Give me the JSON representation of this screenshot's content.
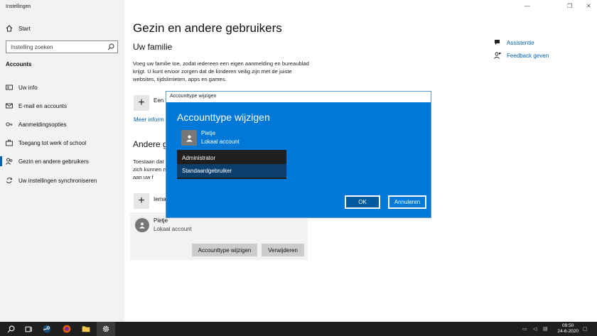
{
  "window": {
    "title": "Instellingen",
    "minimize": "—",
    "maximize": "❐",
    "close": "✕"
  },
  "sidebar": {
    "home_label": "Start",
    "search_placeholder": "Instelling zoeken",
    "section_title": "Accounts",
    "items": [
      {
        "label": "Uw info",
        "icon": "user-card-icon"
      },
      {
        "label": "E-mail en accounts",
        "icon": "mail-icon"
      },
      {
        "label": "Aanmeldingsopties",
        "icon": "key-icon"
      },
      {
        "label": "Toegang tot werk of school",
        "icon": "briefcase-icon"
      },
      {
        "label": "Gezin en andere gebruikers",
        "icon": "people-icon"
      },
      {
        "label": "Uw instellingen synchroniseren",
        "icon": "sync-icon"
      }
    ]
  },
  "main": {
    "title": "Gezin en andere gebruikers",
    "family": {
      "heading": "Uw familie",
      "text": "Voeg uw familie toe, zodat iedereen een eigen aanmelding en bureaublad krijgt. U kunt ervoor zorgen dat de kinderen veilig zijn met de juiste websites, tijdslimieten, apps en games.",
      "add_label": "Een f",
      "more_link": "Meer inform"
    },
    "others": {
      "heading": "Andere ge",
      "text": "Toestaan dat zich kunnen niet aan uw f",
      "add_label": "Iema",
      "user_name": "Pietje",
      "user_type": "Lokaal account",
      "change_button": "Accounttype wijzigen",
      "remove_button": "Verwijderen"
    },
    "help": {
      "assist": "Assistentie",
      "feedback": "Feedback geven"
    }
  },
  "dialog": {
    "titlebar": "Accounttype wijzigen",
    "heading": "Accounttype wijzigen",
    "user_name": "Pietje",
    "user_type": "Lokaal account",
    "options": [
      "Administrator",
      "Standaardgebruiker"
    ],
    "selected": "Standaardgebruiker",
    "ok": "OK",
    "cancel": "Annuleren"
  },
  "taskbar": {
    "time": "09:50",
    "date": "24-6-2020"
  },
  "colors": {
    "accent": "#0078d7",
    "link": "#0063b1",
    "sidebar_bg": "#f2f2f2",
    "taskbar_bg": "#1f1f1f"
  }
}
